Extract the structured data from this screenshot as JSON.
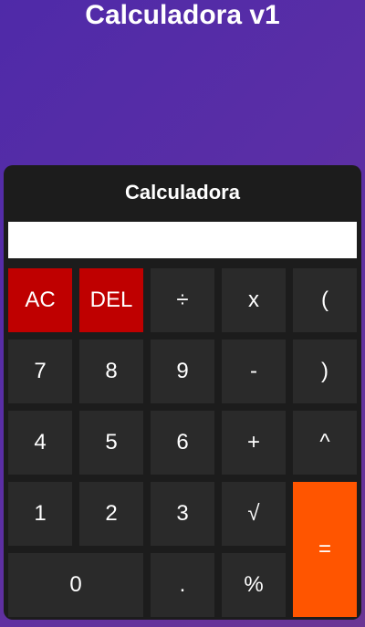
{
  "page": {
    "title": "Calculadora v1"
  },
  "calculator": {
    "title": "Calculadora",
    "display_value": "",
    "colors": {
      "panel": "#1c1c1c",
      "key": "#2a2a2a",
      "danger": "#bf0000",
      "equals": "#ff5500",
      "display": "#ffffff"
    },
    "keys": {
      "ac": "AC",
      "del": "DEL",
      "divide": "÷",
      "multiply": "x",
      "open_paren": "(",
      "seven": "7",
      "eight": "8",
      "nine": "9",
      "minus": "-",
      "close_paren": ")",
      "four": "4",
      "five": "5",
      "six": "6",
      "plus": "+",
      "power": "^",
      "one": "1",
      "two": "2",
      "three": "3",
      "sqrt": "√",
      "equals": "=",
      "zero": "0",
      "decimal": ".",
      "percent": "%"
    }
  }
}
